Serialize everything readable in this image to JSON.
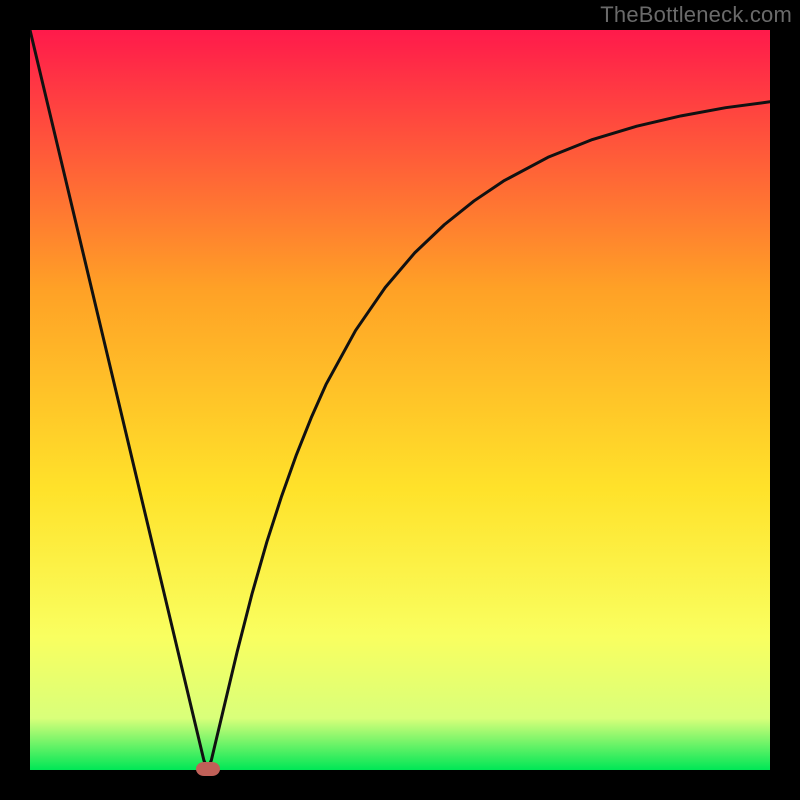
{
  "watermark": "TheBottleneck.com",
  "chart_data": {
    "type": "line",
    "title": "",
    "xlabel": "",
    "ylabel": "",
    "xlim": [
      0,
      100
    ],
    "ylim": [
      0,
      100
    ],
    "grid": false,
    "legend": false,
    "gradient_colors": {
      "top": "#ff1a4b",
      "upper_mid": "#ffa126",
      "mid": "#ffe22a",
      "lower_mid": "#f9ff60",
      "band": "#d9ff7a",
      "bottom": "#00e756"
    },
    "series": [
      {
        "name": "bottleneck-curve",
        "color": "#111111",
        "x": [
          0,
          2,
          4,
          6,
          8,
          10,
          12,
          14,
          16,
          18,
          20,
          21,
          22,
          23,
          23.5,
          24,
          24.5,
          25,
          26,
          27,
          28,
          30,
          32,
          34,
          36,
          38,
          40,
          44,
          48,
          52,
          56,
          60,
          64,
          70,
          76,
          82,
          88,
          94,
          100
        ],
        "y": [
          100,
          91.6,
          83.2,
          74.8,
          66.4,
          58.0,
          49.6,
          41.2,
          32.8,
          24.4,
          16.0,
          11.8,
          7.6,
          3.4,
          1.3,
          0.2,
          1.3,
          3.4,
          7.6,
          11.8,
          16.0,
          23.8,
          30.8,
          37.0,
          42.6,
          47.6,
          52.1,
          59.4,
          65.2,
          69.9,
          73.7,
          76.9,
          79.6,
          82.8,
          85.2,
          87.0,
          88.4,
          89.5,
          90.3
        ]
      }
    ],
    "marker": {
      "name": "optimal-point",
      "x": 24,
      "y": 0.2,
      "color": "#c06058"
    }
  }
}
